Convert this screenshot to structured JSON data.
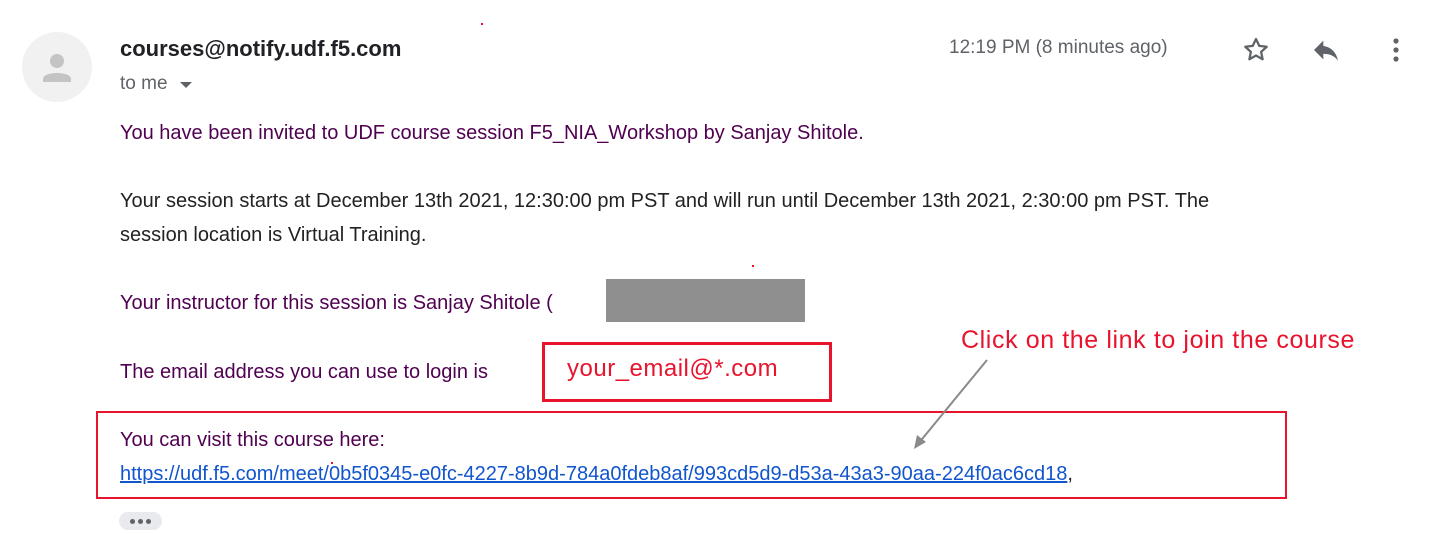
{
  "header": {
    "sender": "courses@notify.udf.f5.com",
    "recipient": "to me",
    "timestamp": "12:19 PM (8 minutes ago)",
    "icons": [
      "star-icon",
      "reply-icon",
      "more-vert-icon"
    ]
  },
  "message": {
    "invite": "You have been invited to UDF course session F5_NIA_Workshop by Sanjay Shitole.",
    "schedule_line1": "Your session starts at December 13th 2021, 12:30:00 pm PST and will run until December 13th 2021, 2:30:00 pm PST. The",
    "schedule_line2": "session location is Virtual Training.",
    "instructor": "Your instructor for this session is Sanjay Shitole (",
    "login_label": "The email address you can use to login is",
    "login_email": "your_email@*.com",
    "visit_label": "You can visit this course here:",
    "course_link": "https://udf.f5.com/meet/0b5f0345-e0fc-4227-8b9d-784a0fdeb8af/993cd5d9-d53a-43a3-90aa-224f0ac6cd18",
    "link_suffix": ","
  },
  "annotation": {
    "callout": "Click on the link to join the course"
  },
  "colors": {
    "annotation_red": "#e8132d",
    "link_blue": "#1155cc",
    "quoted_purple": "#500050",
    "redaction_gray": "#8f8f8f"
  }
}
